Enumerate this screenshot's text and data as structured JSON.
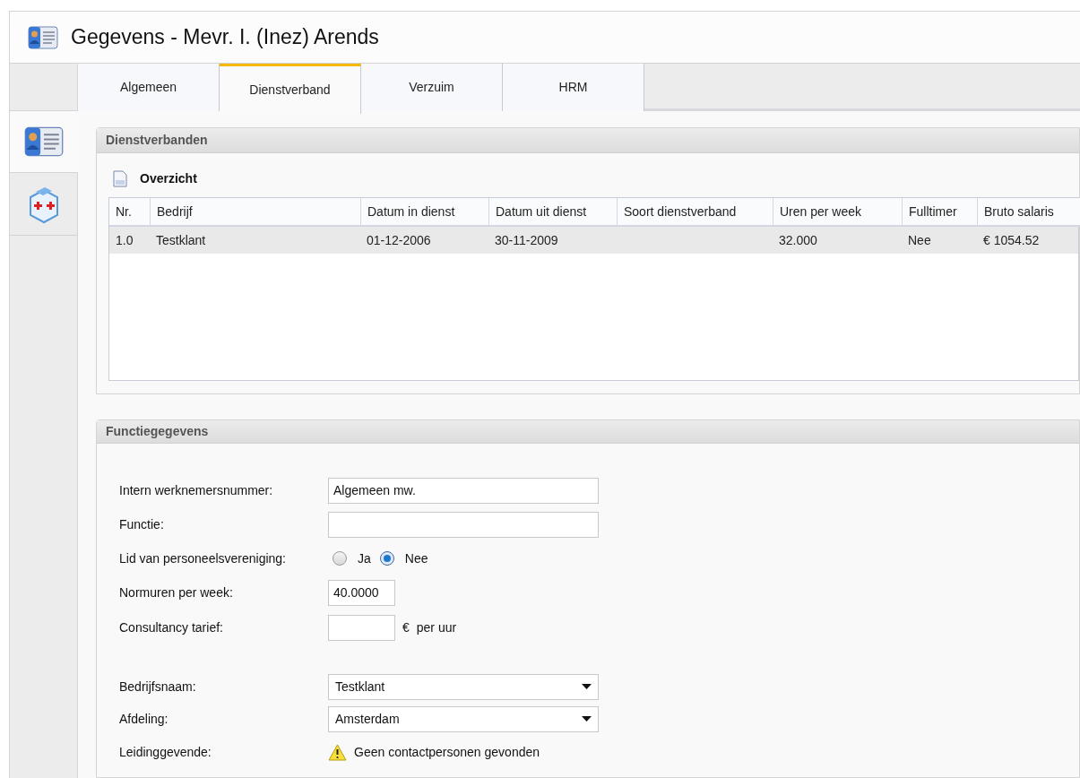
{
  "window": {
    "title": "Gegevens - Mevr. I. (Inez) Arends"
  },
  "side_tabs": [
    {
      "kind": "card",
      "selected": true
    },
    {
      "kind": "medical",
      "selected": false
    }
  ],
  "tabs": [
    {
      "label": "Algemeen",
      "selected": false
    },
    {
      "label": "Dienstverband",
      "selected": true
    },
    {
      "label": "Verzuim",
      "selected": false
    },
    {
      "label": "HRM",
      "selected": false
    }
  ],
  "dienstverbanden": {
    "title": "Dienstverbanden",
    "subtitle": "Overzicht",
    "table": {
      "columns": [
        "Nr.",
        "Bedrijf",
        "Datum in dienst",
        "Datum uit dienst",
        "Soort dienstverband",
        "Uren per week",
        "Fulltimer",
        "Bruto salaris"
      ],
      "rows": [
        {
          "selected": true,
          "cells": [
            "1.0",
            "Testklant",
            "01-12-2006",
            "30-11-2009",
            "",
            "32.000",
            "Nee",
            "€ 1054.52"
          ]
        }
      ]
    }
  },
  "functiegegevens": {
    "title": "Functiegegevens",
    "fields": [
      {
        "kind": "text",
        "label": "Intern werknemersnummer:",
        "value": "Algemeen mw."
      },
      {
        "kind": "text",
        "label": "Functie:"
      },
      {
        "kind": "radio",
        "label": "Lid van personeelsvereniging:",
        "options": [
          {
            "label": "Ja",
            "selected": false
          },
          {
            "label": "Nee",
            "selected": true
          }
        ]
      },
      {
        "kind": "short",
        "label": "Normuren per week:",
        "value": "40.0000"
      },
      {
        "kind": "short",
        "label": "Consultancy tarief:",
        "suffix_symbol": "€",
        "suffix": "per uur"
      },
      {
        "kind": "gap"
      },
      {
        "kind": "select",
        "label": "Bedrijfsnaam:",
        "value": "Testklant"
      },
      {
        "kind": "select",
        "label": "Afdeling:",
        "value": "Amsterdam"
      },
      {
        "kind": "warning",
        "label": "Leidinggevende:",
        "message": "Geen contactpersonen gevonden"
      }
    ]
  }
}
